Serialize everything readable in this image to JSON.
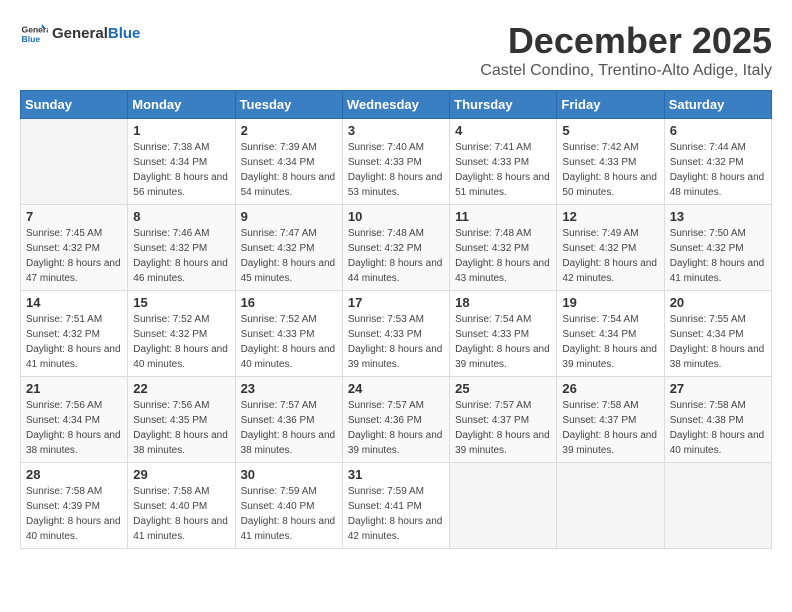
{
  "logo": {
    "text_general": "General",
    "text_blue": "Blue"
  },
  "title": {
    "month": "December 2025",
    "location": "Castel Condino, Trentino-Alto Adige, Italy"
  },
  "header": {
    "days": [
      "Sunday",
      "Monday",
      "Tuesday",
      "Wednesday",
      "Thursday",
      "Friday",
      "Saturday"
    ]
  },
  "weeks": [
    {
      "cells": [
        {
          "empty": true
        },
        {
          "day": "1",
          "sunrise": "7:38 AM",
          "sunset": "4:34 PM",
          "daylight": "8 hours and 56 minutes."
        },
        {
          "day": "2",
          "sunrise": "7:39 AM",
          "sunset": "4:34 PM",
          "daylight": "8 hours and 54 minutes."
        },
        {
          "day": "3",
          "sunrise": "7:40 AM",
          "sunset": "4:33 PM",
          "daylight": "8 hours and 53 minutes."
        },
        {
          "day": "4",
          "sunrise": "7:41 AM",
          "sunset": "4:33 PM",
          "daylight": "8 hours and 51 minutes."
        },
        {
          "day": "5",
          "sunrise": "7:42 AM",
          "sunset": "4:33 PM",
          "daylight": "8 hours and 50 minutes."
        },
        {
          "day": "6",
          "sunrise": "7:44 AM",
          "sunset": "4:32 PM",
          "daylight": "8 hours and 48 minutes."
        }
      ]
    },
    {
      "cells": [
        {
          "day": "7",
          "sunrise": "7:45 AM",
          "sunset": "4:32 PM",
          "daylight": "8 hours and 47 minutes."
        },
        {
          "day": "8",
          "sunrise": "7:46 AM",
          "sunset": "4:32 PM",
          "daylight": "8 hours and 46 minutes."
        },
        {
          "day": "9",
          "sunrise": "7:47 AM",
          "sunset": "4:32 PM",
          "daylight": "8 hours and 45 minutes."
        },
        {
          "day": "10",
          "sunrise": "7:48 AM",
          "sunset": "4:32 PM",
          "daylight": "8 hours and 44 minutes."
        },
        {
          "day": "11",
          "sunrise": "7:48 AM",
          "sunset": "4:32 PM",
          "daylight": "8 hours and 43 minutes."
        },
        {
          "day": "12",
          "sunrise": "7:49 AM",
          "sunset": "4:32 PM",
          "daylight": "8 hours and 42 minutes."
        },
        {
          "day": "13",
          "sunrise": "7:50 AM",
          "sunset": "4:32 PM",
          "daylight": "8 hours and 41 minutes."
        }
      ]
    },
    {
      "cells": [
        {
          "day": "14",
          "sunrise": "7:51 AM",
          "sunset": "4:32 PM",
          "daylight": "8 hours and 41 minutes."
        },
        {
          "day": "15",
          "sunrise": "7:52 AM",
          "sunset": "4:32 PM",
          "daylight": "8 hours and 40 minutes."
        },
        {
          "day": "16",
          "sunrise": "7:52 AM",
          "sunset": "4:33 PM",
          "daylight": "8 hours and 40 minutes."
        },
        {
          "day": "17",
          "sunrise": "7:53 AM",
          "sunset": "4:33 PM",
          "daylight": "8 hours and 39 minutes."
        },
        {
          "day": "18",
          "sunrise": "7:54 AM",
          "sunset": "4:33 PM",
          "daylight": "8 hours and 39 minutes."
        },
        {
          "day": "19",
          "sunrise": "7:54 AM",
          "sunset": "4:34 PM",
          "daylight": "8 hours and 39 minutes."
        },
        {
          "day": "20",
          "sunrise": "7:55 AM",
          "sunset": "4:34 PM",
          "daylight": "8 hours and 38 minutes."
        }
      ]
    },
    {
      "cells": [
        {
          "day": "21",
          "sunrise": "7:56 AM",
          "sunset": "4:34 PM",
          "daylight": "8 hours and 38 minutes."
        },
        {
          "day": "22",
          "sunrise": "7:56 AM",
          "sunset": "4:35 PM",
          "daylight": "8 hours and 38 minutes."
        },
        {
          "day": "23",
          "sunrise": "7:57 AM",
          "sunset": "4:36 PM",
          "daylight": "8 hours and 38 minutes."
        },
        {
          "day": "24",
          "sunrise": "7:57 AM",
          "sunset": "4:36 PM",
          "daylight": "8 hours and 39 minutes."
        },
        {
          "day": "25",
          "sunrise": "7:57 AM",
          "sunset": "4:37 PM",
          "daylight": "8 hours and 39 minutes."
        },
        {
          "day": "26",
          "sunrise": "7:58 AM",
          "sunset": "4:37 PM",
          "daylight": "8 hours and 39 minutes."
        },
        {
          "day": "27",
          "sunrise": "7:58 AM",
          "sunset": "4:38 PM",
          "daylight": "8 hours and 40 minutes."
        }
      ]
    },
    {
      "cells": [
        {
          "day": "28",
          "sunrise": "7:58 AM",
          "sunset": "4:39 PM",
          "daylight": "8 hours and 40 minutes."
        },
        {
          "day": "29",
          "sunrise": "7:58 AM",
          "sunset": "4:40 PM",
          "daylight": "8 hours and 41 minutes."
        },
        {
          "day": "30",
          "sunrise": "7:59 AM",
          "sunset": "4:40 PM",
          "daylight": "8 hours and 41 minutes."
        },
        {
          "day": "31",
          "sunrise": "7:59 AM",
          "sunset": "4:41 PM",
          "daylight": "8 hours and 42 minutes."
        },
        {
          "empty": true
        },
        {
          "empty": true
        },
        {
          "empty": true
        }
      ]
    }
  ]
}
